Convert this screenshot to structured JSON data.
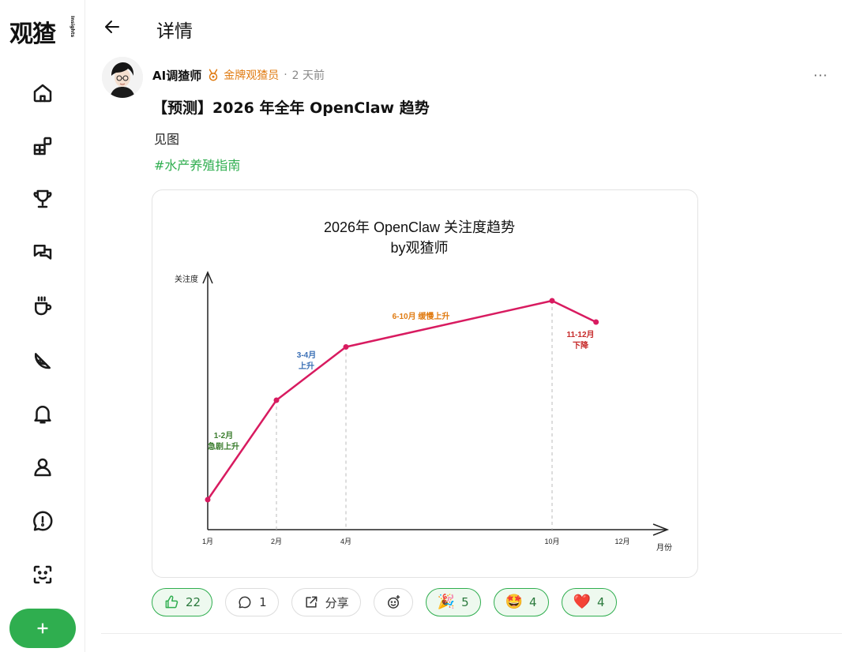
{
  "app": {
    "logo": "观猹",
    "logo_tag": "Insights"
  },
  "header": {
    "title": "详情"
  },
  "post": {
    "author": "AI调猹师",
    "badge": "金牌观猹员",
    "separator": "·",
    "time": "2 天前",
    "more": "···",
    "title": "【预测】2026 年全年 OpenClaw 趋势",
    "body": "见图",
    "hashtag": "#水产养殖指南"
  },
  "reactions": {
    "like": {
      "icon": "thumbs-up-icon",
      "count": "22"
    },
    "comment": {
      "icon": "comment-icon",
      "count": "1"
    },
    "share": {
      "icon": "share-icon",
      "label": "分享"
    },
    "add_emoji": {
      "icon": "add-emoji-icon"
    },
    "party": {
      "emoji": "🎉",
      "count": "5"
    },
    "starstruck": {
      "emoji": "🤩",
      "count": "4"
    },
    "heart": {
      "emoji": "❤️",
      "count": "4"
    }
  },
  "colors": {
    "brand_green": "#2fae4f",
    "badge_orange": "#e07b12",
    "line": "#d81b60"
  },
  "chart_data": {
    "type": "line",
    "title": "2026年 OpenClaw 关注度趋势",
    "subtitle": "by观猹师",
    "ylabel": "关注度",
    "xlabel": "月份",
    "x_ticks": [
      "1月",
      "2月",
      "4月",
      "10月",
      "12月"
    ],
    "x": [
      1,
      2,
      3,
      4,
      10,
      11,
      12,
      13
    ],
    "series": [
      {
        "x": [
          1,
          2,
          4,
          10,
          11.25
        ],
        "y": [
          2,
          30,
          45,
          58,
          52
        ]
      }
    ],
    "annotations": [
      {
        "text": [
          "1-2月",
          "急剧上升"
        ],
        "color": "#3b7d2e"
      },
      {
        "text": [
          "3-4月",
          "上升"
        ],
        "color": "#3a6fb5"
      },
      {
        "text": [
          "6-10月 缓慢上升"
        ],
        "color": "#e07b12"
      },
      {
        "text": [
          "11-12月",
          "下降"
        ],
        "color": "#c62828"
      }
    ]
  }
}
